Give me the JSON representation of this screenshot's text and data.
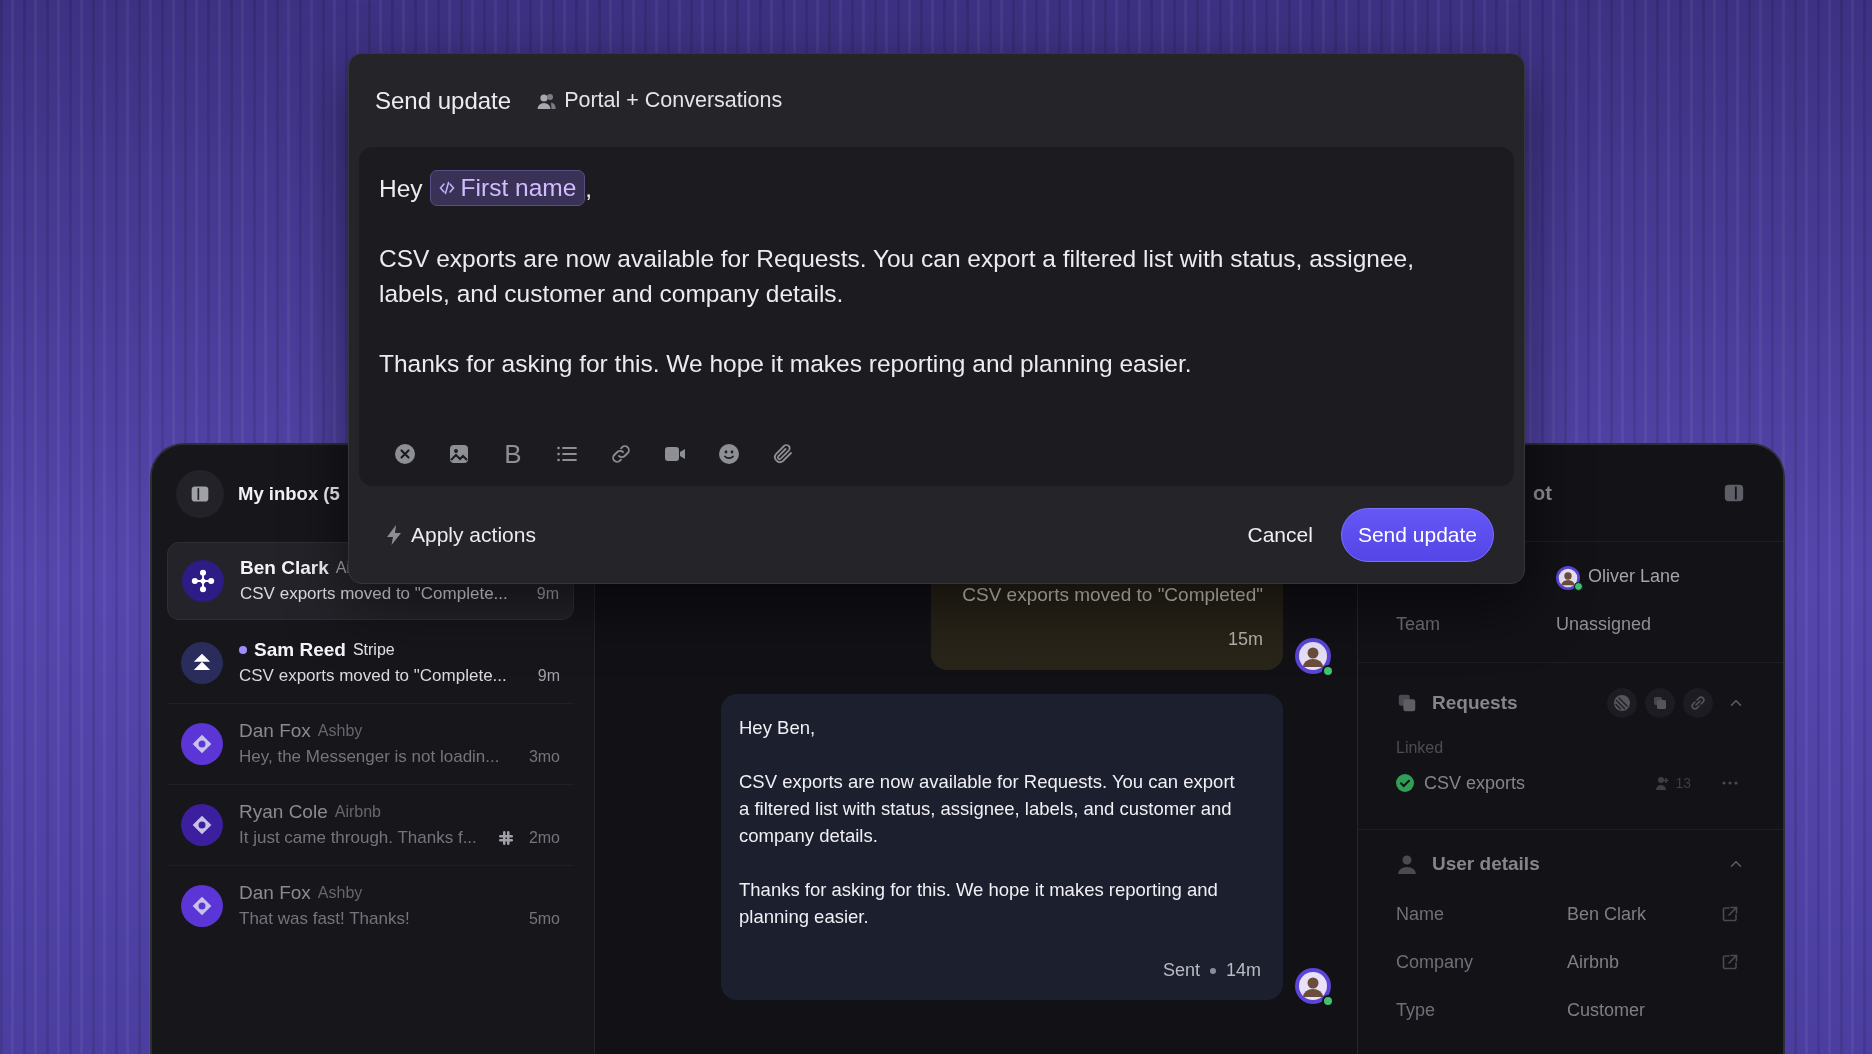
{
  "modal": {
    "title": "Send update",
    "audience": "Portal + Conversations",
    "body": [
      {
        "kind": "greeting",
        "parts": [
          {
            "kind": "text",
            "text": "Hey"
          },
          {
            "kind": "variable",
            "text": "First name"
          },
          {
            "kind": "text",
            "text": ","
          }
        ]
      },
      {
        "kind": "paragraph",
        "text": "CSV exports are now available for Requests. You can export a filtered list with status, assignee, labels, and customer and company details."
      },
      {
        "kind": "paragraph",
        "text": "Thanks for asking for this. We hope it makes reporting and planning easier."
      }
    ],
    "toolbar": [
      {
        "kind": "clear"
      },
      {
        "kind": "image"
      },
      {
        "kind": "bold",
        "glyph": "B"
      },
      {
        "kind": "list"
      },
      {
        "kind": "link"
      },
      {
        "kind": "video"
      },
      {
        "kind": "emoji"
      },
      {
        "kind": "attach"
      }
    ],
    "footer": {
      "action": "Apply actions",
      "cancel": "Cancel",
      "submit": "Send update"
    }
  },
  "inbox": {
    "title": "My inbox (5",
    "conversations": [
      {
        "name": "Ben Clark",
        "company": "Ai",
        "preview": "CSV exports moved to \"Complete...",
        "time": "9m",
        "selected": true,
        "unread": false,
        "color": "#2d1b86",
        "kind": "nodes"
      },
      {
        "name": "Sam Reed",
        "company": "Stripe",
        "preview": "CSV exports moved to \"Complete...",
        "time": "9m",
        "selected": false,
        "unread": true,
        "color": "#2a2d5c",
        "kind": "chevrons"
      },
      {
        "name": "Dan Fox",
        "company": "Ashby",
        "preview": "Hey, the Messenger is not loadin...",
        "time": "3mo",
        "selected": false,
        "unread": false,
        "color": "#5b35d5",
        "kind": "diamond"
      },
      {
        "name": "Ryan Cole",
        "company": "Airbnb",
        "preview": "It just came through. Thanks f...",
        "time": "2mo",
        "selected": false,
        "unread": false,
        "color": "#3b1f9e",
        "kind": "diamond",
        "integration": true
      },
      {
        "name": "Dan Fox",
        "company": "Ashby",
        "preview": "That was fast! Thanks!",
        "time": "5mo",
        "selected": false,
        "unread": false,
        "color": "#5b35d5",
        "kind": "diamond"
      }
    ]
  },
  "conversation": {
    "messages": [
      {
        "kind": "event",
        "text": "CSV exports moved to \"Completed\"",
        "time": "15m",
        "online": true
      },
      {
        "kind": "reply",
        "lines": [
          "Hey Ben,",
          "CSV exports are now available for Requests. You can export a filtered list with status, assignee, labels, and customer and company details.",
          "Thanks for asking for this. We hope it makes reporting and planning easier."
        ],
        "status": "Sent",
        "time": "14m",
        "online": true
      }
    ]
  },
  "details": {
    "title": "ot",
    "assignee": {
      "value": "Oliver Lane",
      "online": true
    },
    "fields": [
      {
        "label": "Team",
        "value": "Unassigned"
      }
    ],
    "requests": {
      "title": "Requests",
      "expanded": true,
      "group": "Linked",
      "items": [
        {
          "title": "CSV exports",
          "done": true,
          "count": "13"
        }
      ]
    },
    "user_details": {
      "title": "User details",
      "expanded": true,
      "fields": [
        {
          "label": "Name",
          "value": "Ben Clark",
          "link": true
        },
        {
          "label": "Company",
          "value": "Airbnb",
          "link": true
        },
        {
          "label": "Type",
          "value": "Customer",
          "link": false
        }
      ]
    }
  }
}
